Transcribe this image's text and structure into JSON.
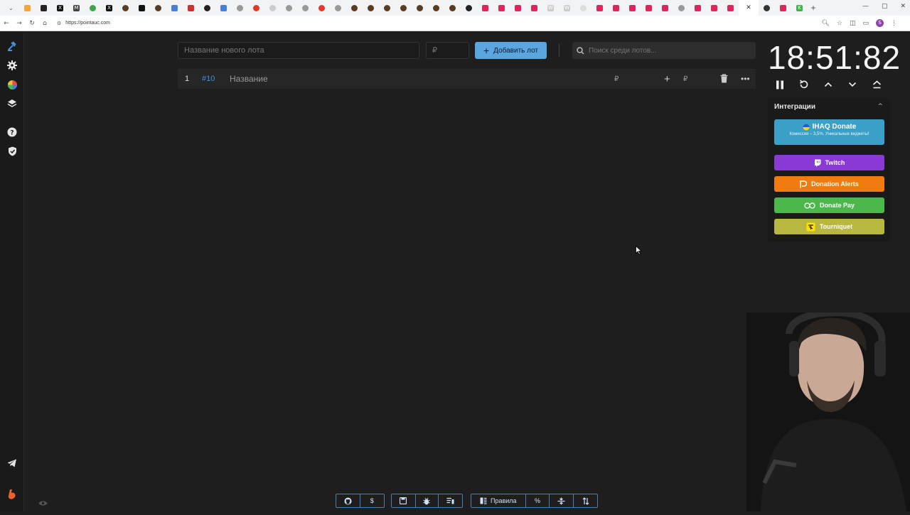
{
  "browser": {
    "url": "https://pointauc.com",
    "profile_initial": "S",
    "window_controls": [
      "—",
      "▢",
      "✕"
    ]
  },
  "sidebar": {
    "items": [
      {
        "icon": "gavel-icon"
      },
      {
        "icon": "gear-icon"
      },
      {
        "icon": "wheel-icon"
      },
      {
        "icon": "layers-icon"
      },
      {
        "icon": "help-icon"
      },
      {
        "icon": "shield-icon"
      },
      {
        "icon": "telegram-icon"
      },
      {
        "icon": "boosty-icon"
      }
    ]
  },
  "lot_form": {
    "name_placeholder": "Название нового лота",
    "price_placeholder": "₽",
    "add_label": "Добавить лот",
    "search_placeholder": "Поиск среди лотов..."
  },
  "lot_row": {
    "number": "1",
    "id": "#10",
    "name": "Название",
    "currency": "₽",
    "plus": "+",
    "currency2": "₽",
    "more": "•••"
  },
  "timer": {
    "value": "18:51:82"
  },
  "integrations": {
    "title": "Интеграции",
    "ihaq": {
      "title": "IHAQ Donate",
      "subtitle": "Комиссия – 3,5%. Уникальные виджеты!"
    },
    "buttons": [
      {
        "label": "Twitch",
        "color": "#8a3ad4"
      },
      {
        "label": "Donation Alerts",
        "color": "#f07b10"
      },
      {
        "label": "Donate Pay",
        "color": "#4cb84c"
      },
      {
        "label": "Tourniquet",
        "color": "#b8b840"
      }
    ]
  },
  "bottom_toolbar": {
    "rules_label": "Правила",
    "percent_label": "%",
    "dollar_label": "$"
  },
  "colors": {
    "accent": "#5aa6e0",
    "background": "#1e1e1e"
  }
}
